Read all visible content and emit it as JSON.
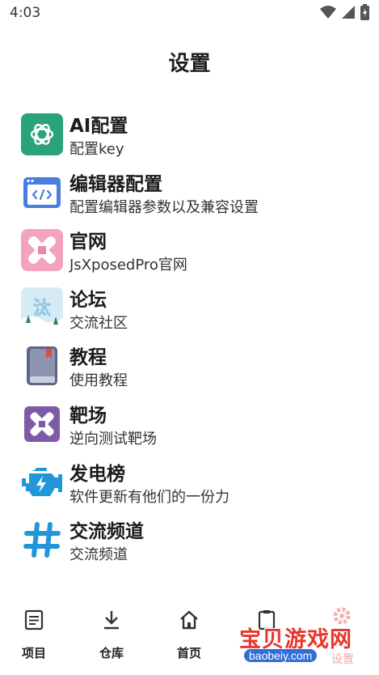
{
  "status_bar": {
    "time": "4:03"
  },
  "page": {
    "title": "设置"
  },
  "menu": [
    {
      "title": "AI配置",
      "subtitle": "配置key",
      "icon": "openai-icon"
    },
    {
      "title": "编辑器配置",
      "subtitle": "配置编辑器参数以及兼容设置",
      "icon": "code-editor-icon"
    },
    {
      "title": "官网",
      "subtitle": "JsXposedPro官网",
      "icon": "website-icon"
    },
    {
      "title": "论坛",
      "subtitle": "交流社区",
      "icon": "forum-icon"
    },
    {
      "title": "教程",
      "subtitle": "使用教程",
      "icon": "book-icon"
    },
    {
      "title": "靶场",
      "subtitle": "逆向测试靶场",
      "icon": "target-range-icon"
    },
    {
      "title": "发电榜",
      "subtitle": "软件更新有他们的一份力",
      "icon": "engine-icon"
    },
    {
      "title": "交流频道",
      "subtitle": "交流频道",
      "icon": "hash-icon"
    }
  ],
  "bottom_nav": [
    {
      "label": "项目",
      "icon": "document-icon"
    },
    {
      "label": "仓库",
      "icon": "download-icon"
    },
    {
      "label": "首页",
      "icon": "home-icon"
    }
  ],
  "watermark": {
    "main": "宝贝游戏网",
    "domain": "baobeiy.com",
    "overlap": "设置"
  },
  "colors": {
    "openai_bg": "#2aa37a",
    "editor_bg": "#4a7de0",
    "website_bg": "#f3a3bd",
    "forum_bg": "#cfe6f3",
    "book_bg": "#6e7791",
    "target_bg": "#7d5aa6",
    "engine_color": "#2196d9",
    "hash_color": "#2196d9"
  }
}
